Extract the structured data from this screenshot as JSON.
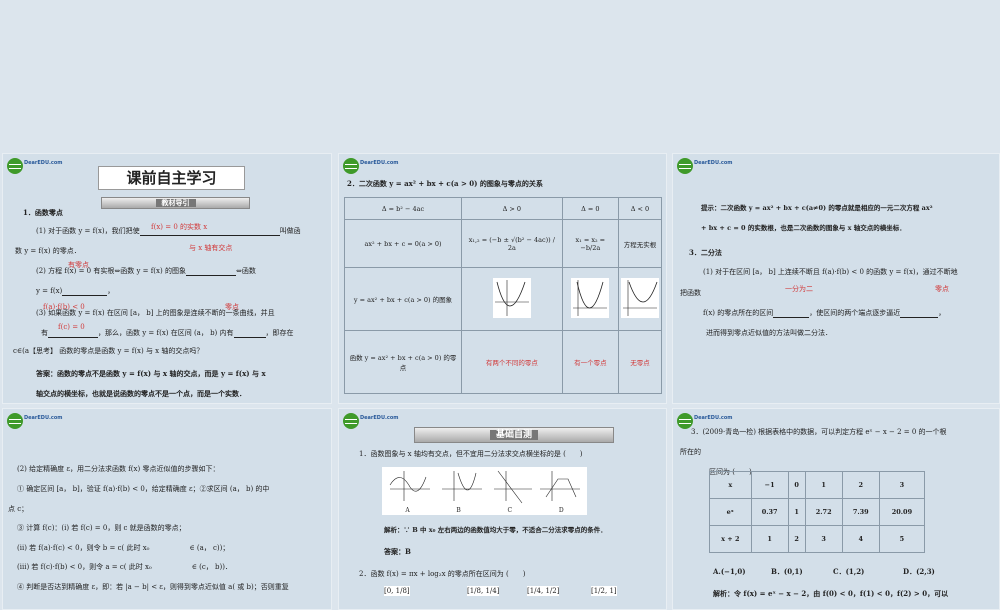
{
  "logo_text": "DearEDU.com",
  "slide1": {
    "banner": "课前自主学习",
    "section": "教材导引",
    "heading": "1．函数零点",
    "line1": "(1) 对于函数 y = f(x)，我们把使",
    "line1_end": "叫做函",
    "line1_answer": "f(x) = 0 的实数 x",
    "line2": "数 y = f(x) 的零点．",
    "line2_answer": "与 x 轴有交点",
    "line3": "(2) 方程 f(x) = 0 有实根⇔函数 y = f(x) 的图象",
    "line3_end": "⇔函数",
    "line3_answer": "有零点",
    "line4": "y = f(x)",
    "line5": "(3) 如果函数 y = f(x) 在区间 [a， b] 上的图象是连续不断的一条曲线，并且",
    "line5_answer1": "f(a)·f(b) < 0",
    "line5_answer2": "零点",
    "line6": "有",
    "line6_mid": "，那么，函数 y = f(x) 在区间 (a， b) 内有",
    "line6_end": "，即存在",
    "line6_answer": "f(c) = 0",
    "line7": "c∈(a【思考】 函数的零点是函数 y = f(x) 与 x 轴的交点吗？",
    "line8": "答案：函数的零点不是函数 y = f(x) 与 x 轴的交点，而是 y = f(x) 与 x",
    "line9": "轴交点的横坐标，也就是说函数的零点不是一个点，而是一个实数．"
  },
  "slide2": {
    "title": "2．二次函数 y = ax² + bx + c(a > 0) 的图象与零点的关系",
    "headers": [
      "Δ = b² − 4ac",
      "Δ > 0",
      "Δ = 0",
      "Δ < 0"
    ],
    "row1": [
      "ax² + bx + c = 0(a > 0)",
      "x₁,₂ = (−b ± √(b² − 4ac)) / 2a",
      "x₁ = x₂ = −b/2a",
      "方程无实根"
    ],
    "row2_label": "y = ax² + bx + c(a > 0) 的图象",
    "row3": [
      "函数 y = ax² + bx + c(a > 0) 的零点",
      "有两个不同的零点",
      "有一个零点",
      "无零点"
    ]
  },
  "slide3": {
    "hint1": "提示：二次函数 y = ax² + bx + c(a≠0) 的零点就是相应的一元二次方程 ax²",
    "hint2": "+ bx + c = 0 的实数根，也是二次函数的图象与 x 轴交点的横坐标．",
    "heading": "3．二分法",
    "line1": "(1) 对于在区间 [a， b] 上连续不断且 f(a)·f(b) < 0 的函数 y = f(x)，通过不断地",
    "line2": "把函数",
    "answer1": "一分为二",
    "answer2": "零点",
    "line3a": "f(x) 的零点所在的区间",
    "line3b": "，使区间的两个端点逐步逼近",
    "line4": "进而得到零点近似值的方法叫做二分法．"
  },
  "slide4": {
    "line1": "(2) 给定精确度 ε，用二分法求函数 f(x) 零点近似值的步骤如下：",
    "line2": "① 确定区间 [a， b]，验证 f(a)·f(b) < 0，给定精确度 ε；②求区间 (a， b) 的中",
    "line3": "点 c；",
    "line4": "③ 计算 f(c)：(ⅰ) 若 f(c) = 0，则 c 就是函数的零点；",
    "line5": "(ⅱ) 若 f(a)·f(c) < 0，则令 b = c( 此时 x₀",
    "line5_end": "∈ (a， c))；",
    "line6": "(ⅲ) 若 f(c)·f(b) < 0，则令 a = c( 此时 x₀",
    "line6_end": "∈ (c， b))．",
    "line7": "④ 判断是否达到精确度 ε，即：若 |a − b| < ε，则得到零点近似值 a( 或 b)；否则重复"
  },
  "slide5": {
    "section": "基础自测",
    "q1": "1．函数图象与 x 轴均有交点，但不宜用二分法求交点横坐标的是 (　　)",
    "options": [
      "A",
      "B",
      "C",
      "D"
    ],
    "analysis": "解析：∵ B 中 x₀ 左右两边的函数值均大于零，不适合二分法求零点的条件．",
    "answer": "答案：B",
    "q2": "2．函数 f(x) = πx + log₂x 的零点所在区间为 (　　)",
    "q2_options": [
      "[0, 1/8]",
      "[1/8, 1/4]",
      "[1/4, 1/2]",
      "[1/2, 1]"
    ]
  },
  "slide6": {
    "q3": "3．(2009·青岛一检) 根据表格中的数据，可以判定方程 eˣ − x − 2 = 0 的一个根",
    "q3b": "所在的",
    "q3c": "区间为 (　　)",
    "table": [
      [
        "x",
        "−1",
        "0",
        "1",
        "2",
        "3"
      ],
      [
        "eˣ",
        "0.37",
        "1",
        "2.72",
        "7.39",
        "20.09"
      ],
      [
        "x + 2",
        "1",
        "2",
        "3",
        "4",
        "5"
      ]
    ],
    "options": [
      "A.(−1,0)",
      "B．(0,1)",
      "C．(1,2)",
      "D．(2,3)"
    ],
    "analysis": "解析：令 f(x) = eˣ − x − 2，由 f(0) < 0，f(1) < 0，f(2) > 0，可以"
  }
}
